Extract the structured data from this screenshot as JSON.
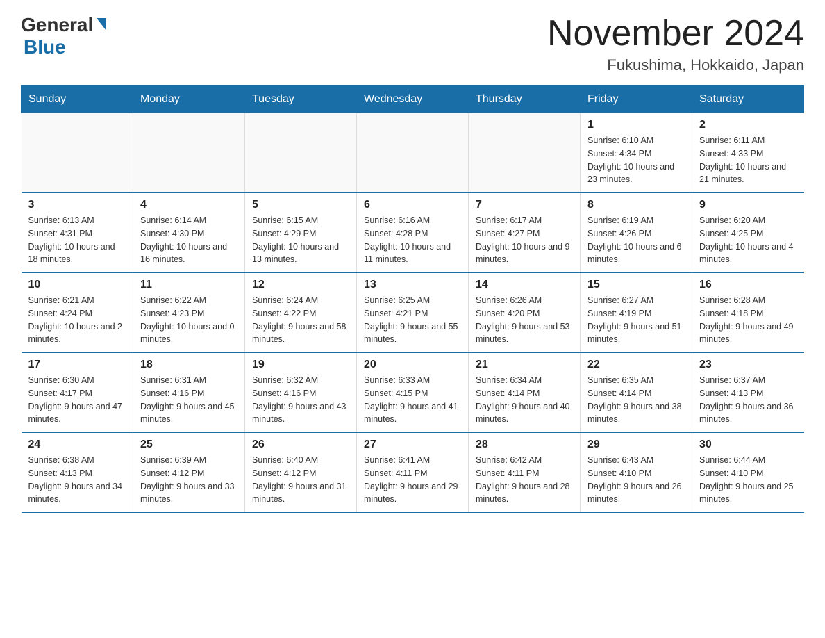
{
  "logo": {
    "general": "General",
    "blue": "Blue"
  },
  "header": {
    "title": "November 2024",
    "subtitle": "Fukushima, Hokkaido, Japan"
  },
  "weekdays": [
    "Sunday",
    "Monday",
    "Tuesday",
    "Wednesday",
    "Thursday",
    "Friday",
    "Saturday"
  ],
  "weeks": [
    [
      {
        "day": "",
        "info": ""
      },
      {
        "day": "",
        "info": ""
      },
      {
        "day": "",
        "info": ""
      },
      {
        "day": "",
        "info": ""
      },
      {
        "day": "",
        "info": ""
      },
      {
        "day": "1",
        "info": "Sunrise: 6:10 AM\nSunset: 4:34 PM\nDaylight: 10 hours and 23 minutes."
      },
      {
        "day": "2",
        "info": "Sunrise: 6:11 AM\nSunset: 4:33 PM\nDaylight: 10 hours and 21 minutes."
      }
    ],
    [
      {
        "day": "3",
        "info": "Sunrise: 6:13 AM\nSunset: 4:31 PM\nDaylight: 10 hours and 18 minutes."
      },
      {
        "day": "4",
        "info": "Sunrise: 6:14 AM\nSunset: 4:30 PM\nDaylight: 10 hours and 16 minutes."
      },
      {
        "day": "5",
        "info": "Sunrise: 6:15 AM\nSunset: 4:29 PM\nDaylight: 10 hours and 13 minutes."
      },
      {
        "day": "6",
        "info": "Sunrise: 6:16 AM\nSunset: 4:28 PM\nDaylight: 10 hours and 11 minutes."
      },
      {
        "day": "7",
        "info": "Sunrise: 6:17 AM\nSunset: 4:27 PM\nDaylight: 10 hours and 9 minutes."
      },
      {
        "day": "8",
        "info": "Sunrise: 6:19 AM\nSunset: 4:26 PM\nDaylight: 10 hours and 6 minutes."
      },
      {
        "day": "9",
        "info": "Sunrise: 6:20 AM\nSunset: 4:25 PM\nDaylight: 10 hours and 4 minutes."
      }
    ],
    [
      {
        "day": "10",
        "info": "Sunrise: 6:21 AM\nSunset: 4:24 PM\nDaylight: 10 hours and 2 minutes."
      },
      {
        "day": "11",
        "info": "Sunrise: 6:22 AM\nSunset: 4:23 PM\nDaylight: 10 hours and 0 minutes."
      },
      {
        "day": "12",
        "info": "Sunrise: 6:24 AM\nSunset: 4:22 PM\nDaylight: 9 hours and 58 minutes."
      },
      {
        "day": "13",
        "info": "Sunrise: 6:25 AM\nSunset: 4:21 PM\nDaylight: 9 hours and 55 minutes."
      },
      {
        "day": "14",
        "info": "Sunrise: 6:26 AM\nSunset: 4:20 PM\nDaylight: 9 hours and 53 minutes."
      },
      {
        "day": "15",
        "info": "Sunrise: 6:27 AM\nSunset: 4:19 PM\nDaylight: 9 hours and 51 minutes."
      },
      {
        "day": "16",
        "info": "Sunrise: 6:28 AM\nSunset: 4:18 PM\nDaylight: 9 hours and 49 minutes."
      }
    ],
    [
      {
        "day": "17",
        "info": "Sunrise: 6:30 AM\nSunset: 4:17 PM\nDaylight: 9 hours and 47 minutes."
      },
      {
        "day": "18",
        "info": "Sunrise: 6:31 AM\nSunset: 4:16 PM\nDaylight: 9 hours and 45 minutes."
      },
      {
        "day": "19",
        "info": "Sunrise: 6:32 AM\nSunset: 4:16 PM\nDaylight: 9 hours and 43 minutes."
      },
      {
        "day": "20",
        "info": "Sunrise: 6:33 AM\nSunset: 4:15 PM\nDaylight: 9 hours and 41 minutes."
      },
      {
        "day": "21",
        "info": "Sunrise: 6:34 AM\nSunset: 4:14 PM\nDaylight: 9 hours and 40 minutes."
      },
      {
        "day": "22",
        "info": "Sunrise: 6:35 AM\nSunset: 4:14 PM\nDaylight: 9 hours and 38 minutes."
      },
      {
        "day": "23",
        "info": "Sunrise: 6:37 AM\nSunset: 4:13 PM\nDaylight: 9 hours and 36 minutes."
      }
    ],
    [
      {
        "day": "24",
        "info": "Sunrise: 6:38 AM\nSunset: 4:13 PM\nDaylight: 9 hours and 34 minutes."
      },
      {
        "day": "25",
        "info": "Sunrise: 6:39 AM\nSunset: 4:12 PM\nDaylight: 9 hours and 33 minutes."
      },
      {
        "day": "26",
        "info": "Sunrise: 6:40 AM\nSunset: 4:12 PM\nDaylight: 9 hours and 31 minutes."
      },
      {
        "day": "27",
        "info": "Sunrise: 6:41 AM\nSunset: 4:11 PM\nDaylight: 9 hours and 29 minutes."
      },
      {
        "day": "28",
        "info": "Sunrise: 6:42 AM\nSunset: 4:11 PM\nDaylight: 9 hours and 28 minutes."
      },
      {
        "day": "29",
        "info": "Sunrise: 6:43 AM\nSunset: 4:10 PM\nDaylight: 9 hours and 26 minutes."
      },
      {
        "day": "30",
        "info": "Sunrise: 6:44 AM\nSunset: 4:10 PM\nDaylight: 9 hours and 25 minutes."
      }
    ]
  ]
}
